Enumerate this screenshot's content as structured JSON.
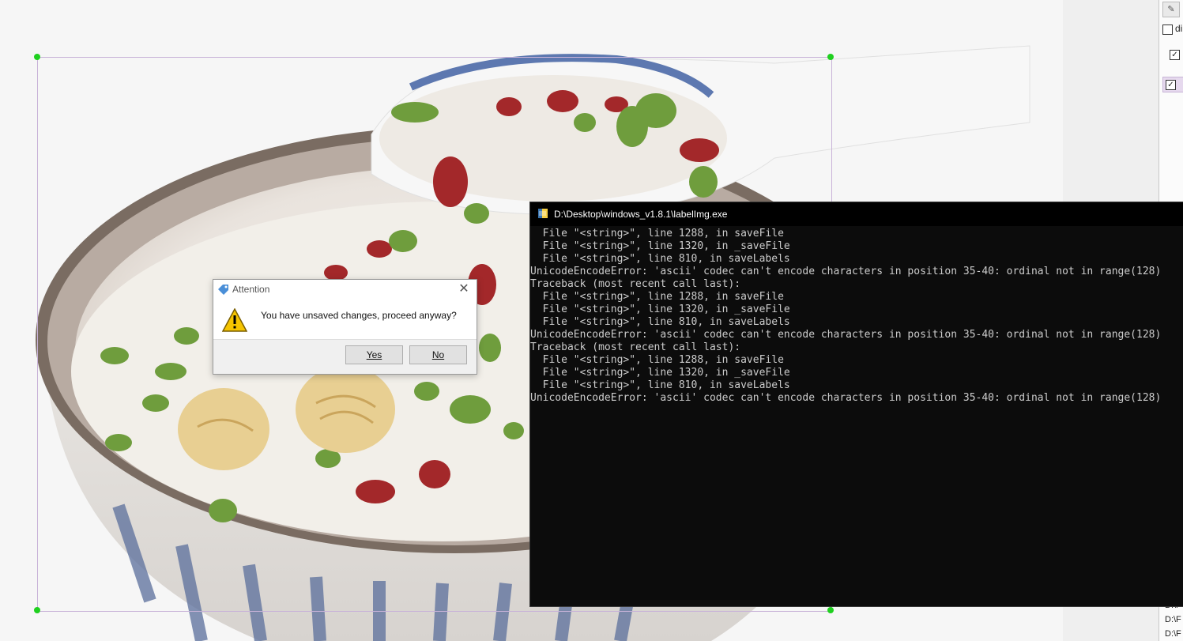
{
  "dialog": {
    "title": "Attention",
    "message": "You have unsaved changes, proceed anyway?",
    "yes_label": "Yes",
    "no_label": "No",
    "close_icon": "close-icon",
    "warning_icon": "warning-icon"
  },
  "console": {
    "title": "D:\\Desktop\\windows_v1.8.1\\labelImg.exe",
    "lines": [
      "  File \"<string>\", line 1288, in saveFile",
      "  File \"<string>\", line 1320, in _saveFile",
      "  File \"<string>\", line 810, in saveLabels",
      "UnicodeEncodeError: 'ascii' codec can't encode characters in position 35-40: ordinal not in range(128)",
      "Traceback (most recent call last):",
      "  File \"<string>\", line 1288, in saveFile",
      "  File \"<string>\", line 1320, in _saveFile",
      "  File \"<string>\", line 810, in saveLabels",
      "UnicodeEncodeError: 'ascii' codec can't encode characters in position 35-40: ordinal not in range(128)",
      "Traceback (most recent call last):",
      "  File \"<string>\", line 1288, in saveFile",
      "  File \"<string>\", line 1320, in _saveFile",
      "  File \"<string>\", line 810, in saveLabels",
      "UnicodeEncodeError: 'ascii' codec can't encode characters in position 35-40: ordinal not in range(128)"
    ]
  },
  "dock": {
    "edit_button": "✎",
    "difficult_label": "di",
    "file_list": [
      "D:\\F",
      "D:\\F",
      "D:\\F"
    ]
  },
  "colors": {
    "bbox_stroke": "#c8b2d8",
    "handle": "#1fd01f",
    "console_bg": "#0c0c0c",
    "console_text": "#cccccc"
  }
}
